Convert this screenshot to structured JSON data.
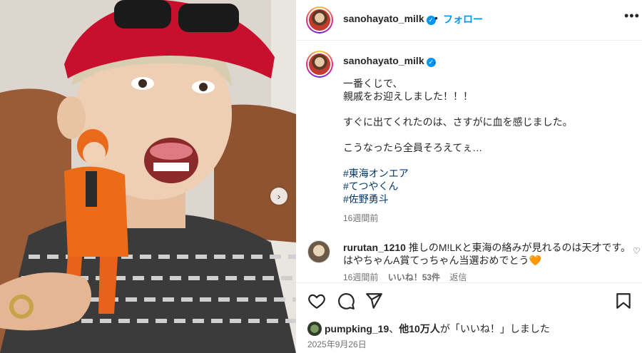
{
  "post": {
    "username": "sanohayato_milk",
    "follow_label": "フォロー",
    "separator": "•",
    "more_label": "•••",
    "caption": {
      "username": "sanohayato_milk",
      "trailing": ".",
      "line1": "一番くじで、",
      "line2": "親戚をお迎えしました！！！",
      "line3": "すぐに出てくれたのは、さすがに血を感じました。",
      "line4": "こうなったら全員そろえてぇ…",
      "hashtags": [
        "#東海オンエア",
        "#てつやくん",
        "#佐野勇斗"
      ],
      "time": "16週間前"
    },
    "comment": {
      "username": "rurutan_1210",
      "text_line1": "推しのM!LKと東海の絡みが見れるのは天才です。",
      "text_line2": "はやちゃんA賞てっちゃん当選おめでとう",
      "emoji": "🧡",
      "time": "16週間前",
      "likes": "いいね！53件",
      "reply": "返信"
    },
    "liked_by": {
      "user": "pumpking_19",
      "separator": "、",
      "others": "他10万人",
      "suffix": "が「いいね！」しました"
    },
    "date": "2025年9月26日",
    "next_arrow": "›"
  },
  "icons": {
    "verified": "verified-badge-icon",
    "like": "heart-icon",
    "comment": "comment-icon",
    "share": "share-icon",
    "save": "bookmark-icon"
  },
  "colors": {
    "link": "#0095f6",
    "hashtag": "#00376b",
    "muted": "#737373"
  }
}
